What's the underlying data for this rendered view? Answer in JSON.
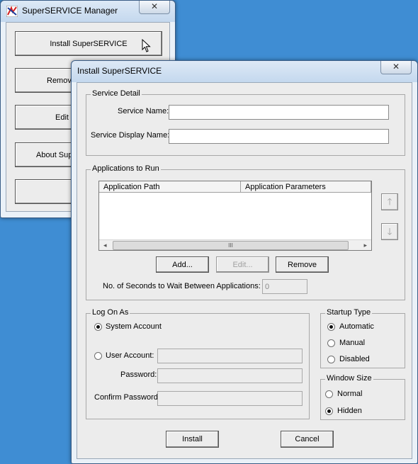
{
  "manager": {
    "title": "SuperSERVICE Manager",
    "close": "✕",
    "buttons": [
      "Install SuperSERVICE",
      "Remov",
      "Edit S",
      "About Supe",
      ""
    ]
  },
  "dialog": {
    "title": "Install SuperSERVICE",
    "close": "✕",
    "service_detail": {
      "legend": "Service Detail",
      "name_label": "Service Name:",
      "name_value": "",
      "display_label": "Service Display Name:",
      "display_value": ""
    },
    "apps": {
      "legend": "Applications to Run",
      "columns": [
        "Application Path",
        "Application Parameters"
      ],
      "rows": [],
      "scroll_grip": "III",
      "scroll_left": "◂",
      "scroll_right": "▸",
      "move_up": "🡑",
      "move_down": "🡓",
      "add": "Add...",
      "edit": "Edit...",
      "remove": "Remove",
      "wait_label": "No. of Seconds to Wait Between Applications:",
      "wait_value": "0"
    },
    "logon": {
      "legend": "Log On As",
      "system_account": "System Account",
      "user_account": "User Account:",
      "password": "Password:",
      "confirm_password": "Confirm Password:"
    },
    "startup": {
      "legend": "Startup Type",
      "automatic": "Automatic",
      "manual": "Manual",
      "disabled": "Disabled"
    },
    "window_size": {
      "legend": "Window Size",
      "normal": "Normal",
      "hidden": "Hidden"
    },
    "install": "Install",
    "cancel": "Cancel"
  },
  "colors": {
    "desktop": "#3f8dd3",
    "dialog_face": "#ececec"
  }
}
